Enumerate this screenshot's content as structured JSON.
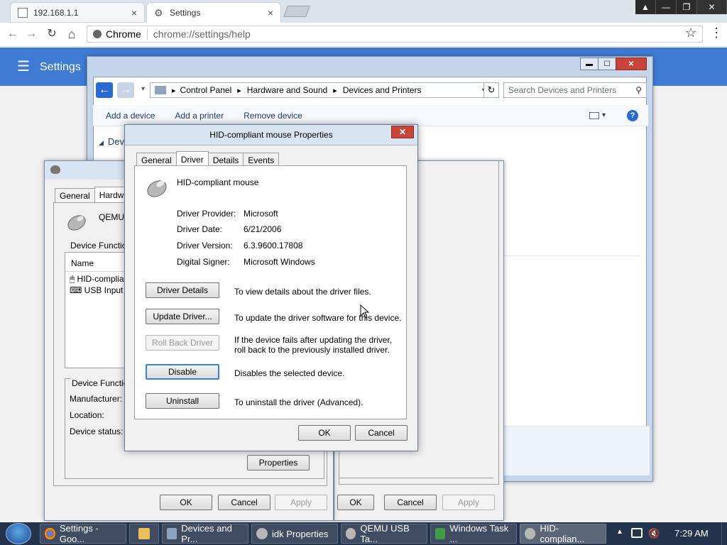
{
  "chrome": {
    "tabs": [
      {
        "title": "192.168.1.1",
        "close": "×"
      },
      {
        "title": "Settings",
        "close": "×"
      }
    ],
    "window_controls": [
      "▲",
      "—",
      "❐",
      "✕"
    ],
    "nav": {
      "back": "←",
      "forward": "→",
      "reload": "↻",
      "home": "⌂"
    },
    "omnibox": {
      "site": "Chrome",
      "url": "chrome://settings/help"
    },
    "star": "☆",
    "menu": "⋮",
    "settings_title": "Settings",
    "hamburger": "☰"
  },
  "devices_printers": {
    "breadcrumb": [
      "Control Panel",
      "Hardware and Sound",
      "Devices and Printers"
    ],
    "search_placeholder": "Search Devices and Printers",
    "toolbar": [
      "Add a device",
      "Add a printer",
      "Remove device"
    ],
    "section": "Dev",
    "buttons": {
      "ok": "OK",
      "cancel": "Cancel",
      "apply": "Apply"
    }
  },
  "idk_properties": {
    "tabs": [
      "General",
      "Hardware"
    ],
    "device_name": "QEMU",
    "functions_label": "Device Function",
    "column_name": "Name",
    "items": [
      "HID-complian",
      "USB Input De"
    ],
    "props_heading": "Device Function",
    "manufacturer": "Manufacturer:",
    "location": "Location:",
    "status": "Device status:",
    "properties_button": "Properties",
    "buttons": {
      "ok": "OK",
      "cancel": "Cancel",
      "apply": "Apply"
    }
  },
  "hid_dialog": {
    "title": "HID-compliant mouse Properties",
    "close": "✕",
    "tabs": [
      "General",
      "Driver",
      "Details",
      "Events"
    ],
    "selected_tab": "Driver",
    "device_name": "HID-compliant mouse",
    "info": [
      {
        "label": "Driver Provider:",
        "value": "Microsoft"
      },
      {
        "label": "Driver Date:",
        "value": "6/21/2006"
      },
      {
        "label": "Driver Version:",
        "value": "6.3.9600.17808"
      },
      {
        "label": "Digital Signer:",
        "value": "Microsoft Windows"
      }
    ],
    "actions": [
      {
        "button": "Driver Details",
        "desc": "To view details about the driver files."
      },
      {
        "button": "Update Driver...",
        "desc": "To update the driver software for this device."
      },
      {
        "button": "Roll Back Driver",
        "desc": "If the device fails after updating the driver, roll back to the previously installed driver."
      },
      {
        "button": "Disable",
        "desc": "Disables the selected device."
      },
      {
        "button": "Uninstall",
        "desc": "To uninstall the driver (Advanced)."
      }
    ],
    "ok": "OK",
    "cancel": "Cancel"
  },
  "taskbar": {
    "items": [
      "Settings - Goo...",
      "",
      "Devices and Pr...",
      "idk Properties",
      "QEMU USB Ta...",
      "Windows Task ...",
      "HID-complian..."
    ],
    "tray_arrow": "▲",
    "clock": "7:29 AM"
  }
}
